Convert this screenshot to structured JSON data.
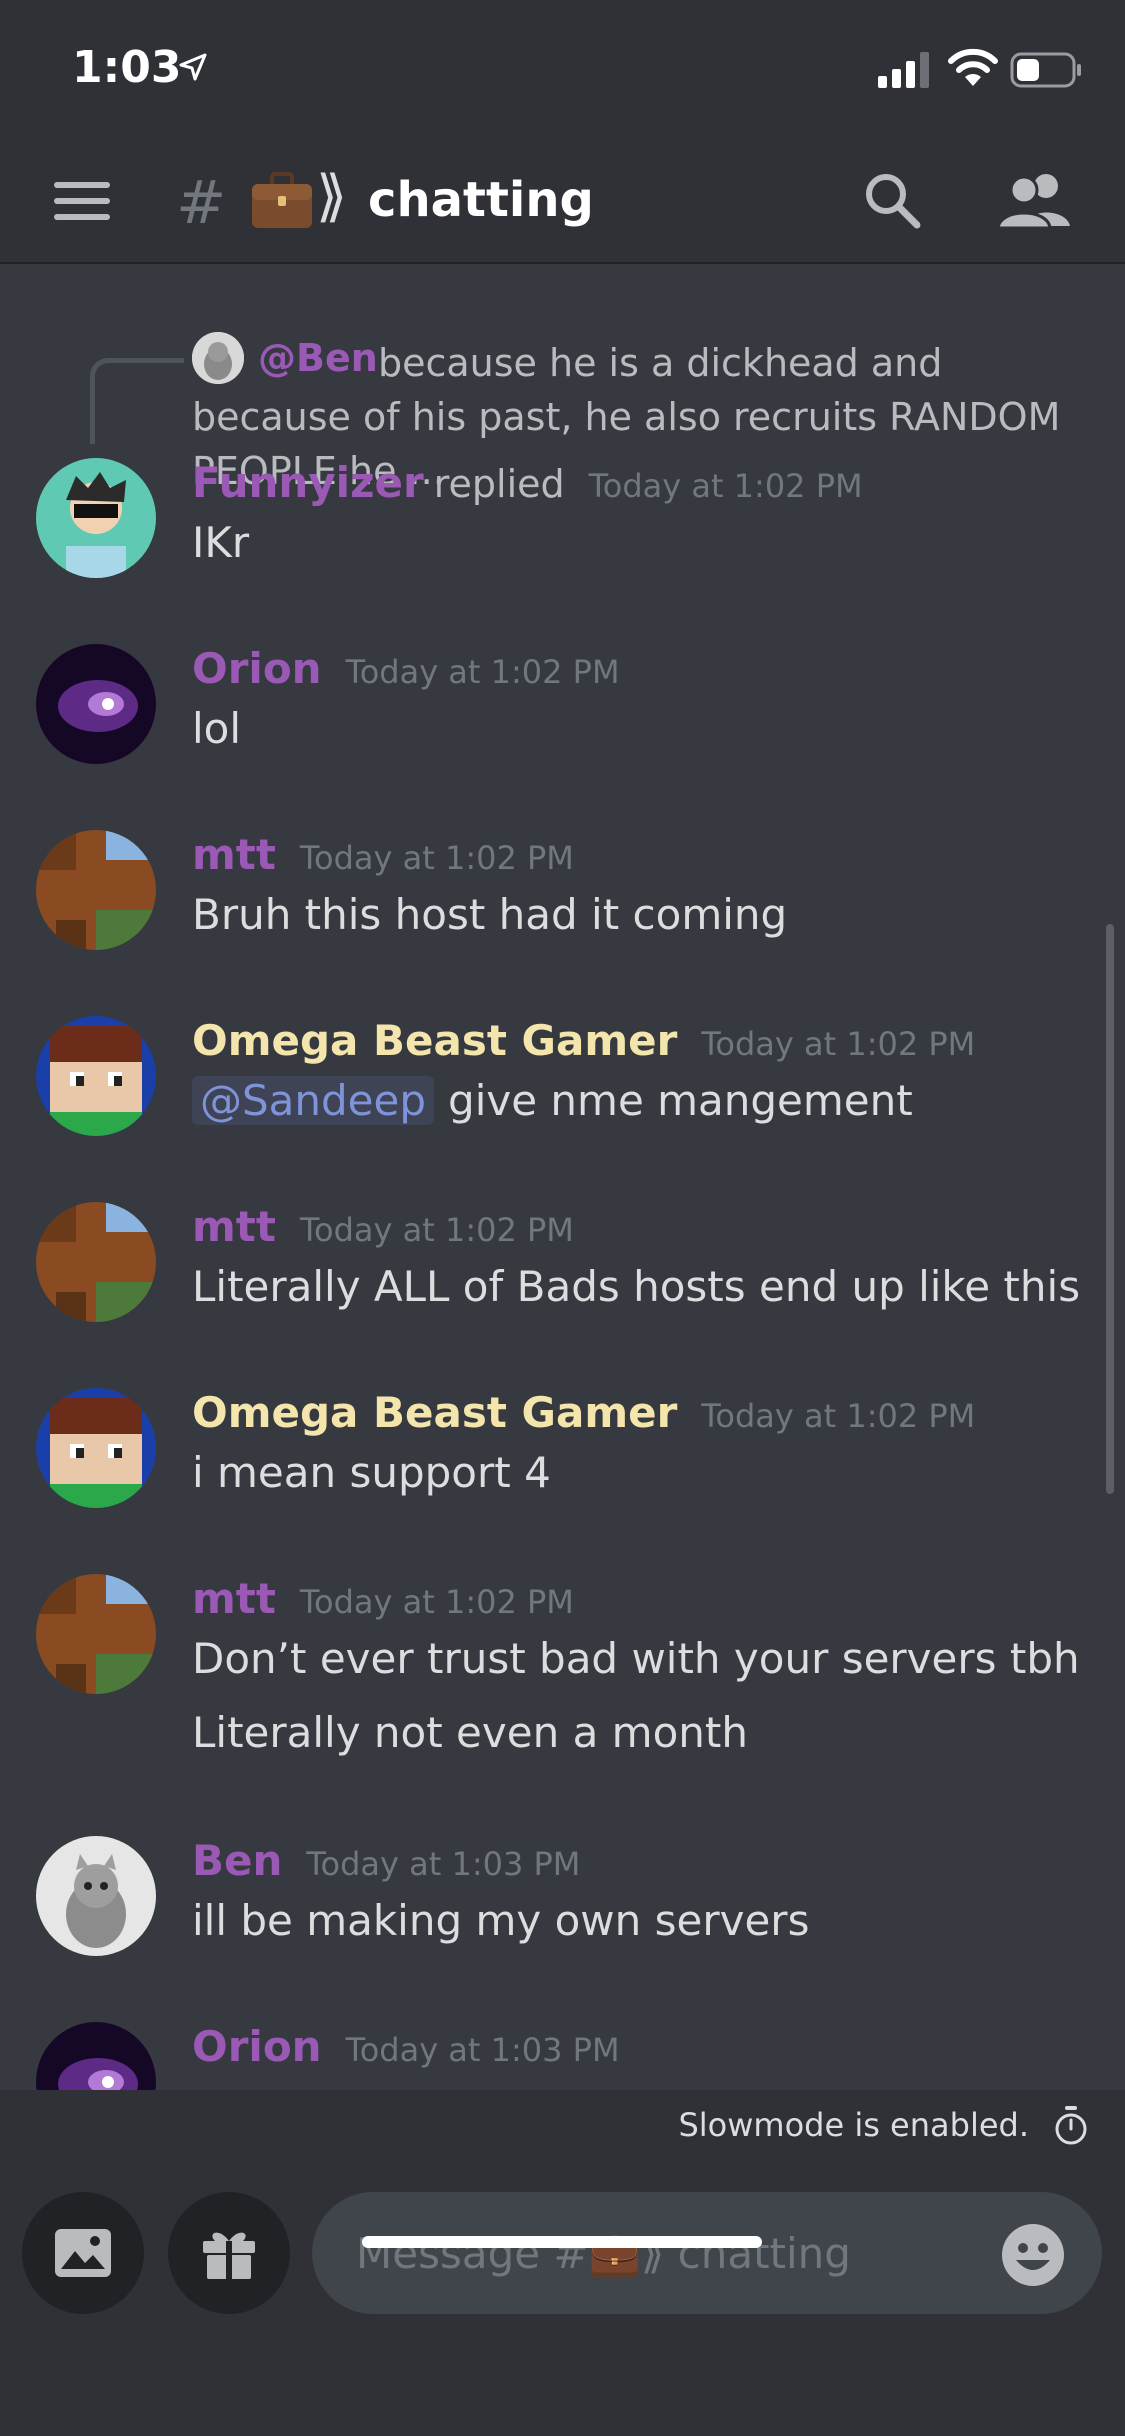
{
  "status_bar": {
    "time": "1:03"
  },
  "header": {
    "channel_name": "chatting",
    "hash": "#",
    "chevrons": "⟫"
  },
  "reply_preview": {
    "mention": "@Ben",
    "text": "because he is a dickhead and because of his past, he also recruits RANDOM PEOPLE he ..."
  },
  "messages": [
    {
      "author": "Funnyizer",
      "replied_label": "replied",
      "timestamp": "Today at 1:02 PM",
      "lines": [
        "IKr"
      ]
    },
    {
      "author": "Orion",
      "timestamp": "Today at 1:02 PM",
      "lines": [
        "lol"
      ]
    },
    {
      "author": "mtt",
      "timestamp": "Today at 1:02 PM",
      "lines": [
        "Bruh this host had it coming"
      ]
    },
    {
      "author": "Omega Beast Gamer",
      "timestamp": "Today at 1:02 PM",
      "mention": "@Sandeep",
      "lines": [
        "give nme mangement"
      ]
    },
    {
      "author": "mtt",
      "timestamp": "Today at 1:02 PM",
      "lines": [
        "Literally ALL of Bads hosts end up like this"
      ]
    },
    {
      "author": "Omega Beast Gamer",
      "timestamp": "Today at 1:02 PM",
      "lines": [
        "i mean support 4"
      ]
    },
    {
      "author": "mtt",
      "timestamp": "Today at 1:02 PM",
      "lines": [
        "Don’t ever trust bad with your servers tbh",
        "Literally not even a month"
      ]
    },
    {
      "author": "Ben",
      "timestamp": "Today at 1:03 PM",
      "lines": [
        "ill be making my own servers"
      ]
    },
    {
      "author": "Orion",
      "timestamp": "Today at 1:03 PM",
      "lines": []
    }
  ],
  "slowmode": {
    "text": "Slowmode is enabled."
  },
  "composer": {
    "placeholder": "Message #💼⟫ chatting"
  },
  "colors": {
    "background": "#36393f",
    "header": "#2f3136",
    "username_purple": "#9b59b6",
    "username_cream": "#f3e5ab",
    "mention": "#7f93d9"
  }
}
